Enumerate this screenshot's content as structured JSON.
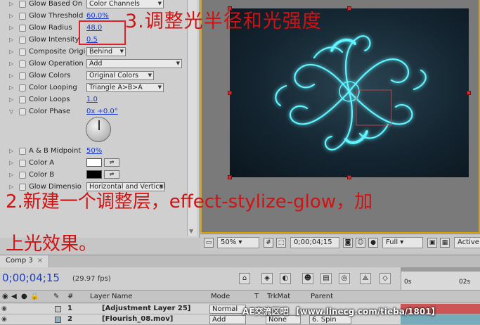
{
  "effect_controls": {
    "rows": [
      {
        "name": "Glow Based On",
        "type": "dropdown",
        "value": "Color Channels"
      },
      {
        "name": "Glow Threshold",
        "type": "link",
        "value": "60.0%"
      },
      {
        "name": "Glow Radius",
        "type": "link",
        "value": "48.0"
      },
      {
        "name": "Glow Intensity",
        "type": "link",
        "value": "0.5"
      },
      {
        "name": "Composite Origi",
        "type": "dropdown",
        "value": "Behind"
      },
      {
        "name": "Glow Operation",
        "type": "dropdown",
        "value": "Add"
      },
      {
        "name": "Glow Colors",
        "type": "dropdown",
        "value": "Original Colors"
      },
      {
        "name": "Color Looping",
        "type": "dropdown",
        "value": "Triangle A>B>A"
      },
      {
        "name": "Color Loops",
        "type": "link",
        "value": "1.0"
      },
      {
        "name": "Color Phase",
        "type": "link",
        "value": "0x +0.0°"
      },
      {
        "name": "A & B Midpoint",
        "type": "link",
        "value": "50%"
      },
      {
        "name": "Color A",
        "type": "color",
        "value": "#ffffff"
      },
      {
        "name": "Color B",
        "type": "color",
        "value": "#000000"
      },
      {
        "name": "Glow Dimensio",
        "type": "dropdown",
        "value": "Horizontal and Vertical"
      }
    ]
  },
  "annotations": {
    "step3": "3.调整光半径和光强度",
    "step2_line1": "2.新建一个调整层，effect-stylize-glow，加",
    "step2_line2": "上光效果。"
  },
  "viewer": {
    "zoom": "50%",
    "timecode": "0;00;04;15",
    "resolution": "Full",
    "camera": "Active"
  },
  "timeline": {
    "tab_label": "Comp 3",
    "timecode": "0;00;04;15",
    "fps": "(29.97 fps)",
    "ruler": [
      "0s",
      "02s"
    ],
    "columns": {
      "hash": "#",
      "layer_name": "Layer Name",
      "mode": "Mode",
      "t": "T",
      "trkmat": "TrkMat",
      "parent": "Parent"
    },
    "layers": [
      {
        "num": "1",
        "name": "[Adjustment Layer 25]",
        "mode": "Normal",
        "trkmat": "",
        "parent": "",
        "label_color": "#c8c8c8"
      },
      {
        "num": "2",
        "name": "[Flourish_08.mov]",
        "mode": "Add",
        "trkmat": "None",
        "parent": "6. Spin",
        "label_color": "#8fb3c4"
      }
    ]
  },
  "watermark": "AE交流区吧 【www.linecg.com/tieba/1801】",
  "colors": {
    "accent_blue": "#1a3cc8",
    "annotation_red": "#d21212",
    "glow_cyan": "#5ff4ff",
    "frame_orange": "#d8a300"
  }
}
